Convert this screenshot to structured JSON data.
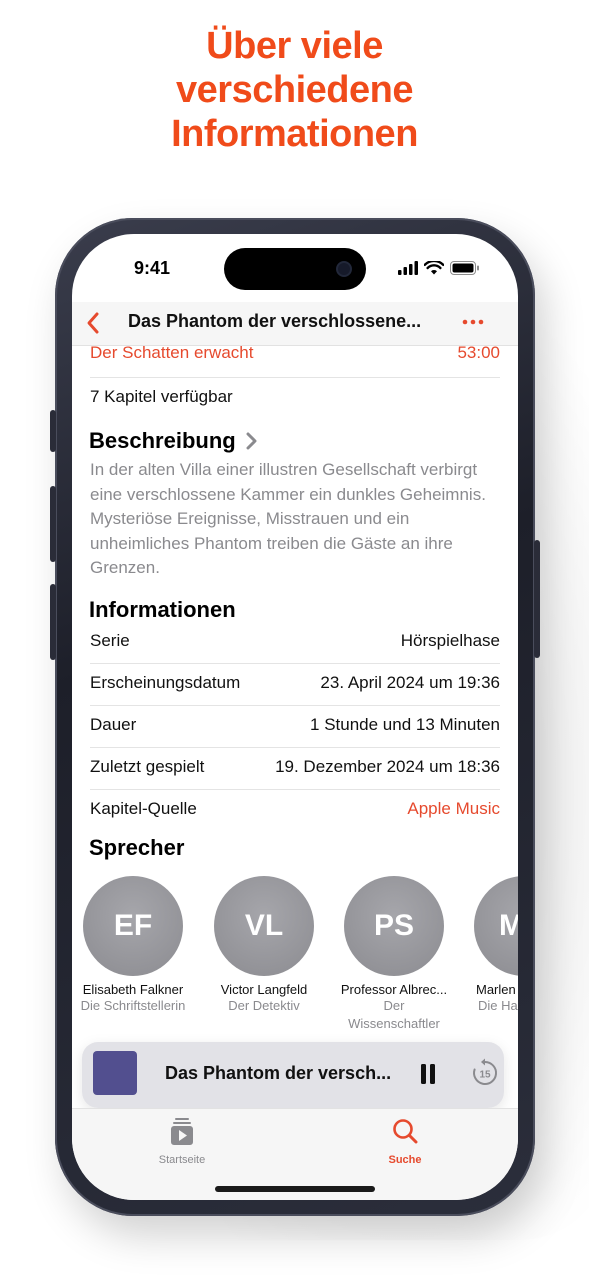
{
  "headline": {
    "line1": "Über viele",
    "line2": "verschiedene",
    "line3": "Informationen"
  },
  "status_bar": {
    "time": "9:41"
  },
  "nav": {
    "title": "Das Phantom der verschlossene...",
    "back_icon": "chevron-left-icon",
    "more_icon": "ellipsis-icon"
  },
  "previous_chapter": {
    "title": "Der Schatten erwacht",
    "duration": "53:00"
  },
  "chapters_available": "7 Kapitel verfügbar",
  "description": {
    "heading": "Beschreibung",
    "text": "In der alten Villa einer illustren Gesellschaft verbirgt eine verschlossene Kammer ein dunkles Geheimnis. Mysteriöse Ereignisse, Misstrauen und ein unheimliches Phantom treiben die Gäste an ihre Grenzen."
  },
  "information": {
    "heading": "Informationen",
    "rows": [
      {
        "label": "Serie",
        "value": "Hörspielhase"
      },
      {
        "label": "Erscheinungsdatum",
        "value": "23. April 2024 um 19:36"
      },
      {
        "label": "Dauer",
        "value": "1 Stunde und 13 Minuten"
      },
      {
        "label": "Zuletzt gespielt",
        "value": "19. Dezember 2024 um 18:36"
      },
      {
        "label": "Kapitel-Quelle",
        "value": "Apple Music"
      }
    ]
  },
  "speakers": {
    "heading": "Sprecher",
    "items": [
      {
        "initials": "EF",
        "name": "Elisabeth Falkner",
        "role": "Die Schriftstellerin"
      },
      {
        "initials": "VL",
        "name": "Victor Langfeld",
        "role": "Der Detektiv"
      },
      {
        "initials": "PS",
        "name": "Professor Albrec...",
        "role": "Der Wissenschaftler"
      },
      {
        "initials": "M",
        "name": "Marlen",
        "role": "Die Ha"
      }
    ]
  },
  "mini_player": {
    "title": "Das Phantom der versch...",
    "skip_label": "15",
    "artwork_color": "#524f8f"
  },
  "tabs": [
    {
      "label": "Startseite",
      "icon": "home-play-icon",
      "active": false
    },
    {
      "label": "Suche",
      "icon": "search-icon",
      "active": true
    }
  ],
  "colors": {
    "accent": "#f04b1a",
    "link": "#e64a2e",
    "secondary_text": "#8a8a8e"
  }
}
